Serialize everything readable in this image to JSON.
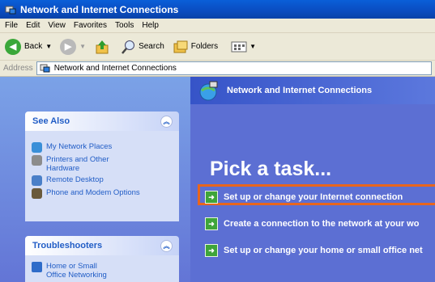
{
  "window": {
    "title": "Network and Internet Connections"
  },
  "menu": [
    "File",
    "Edit",
    "View",
    "Favorites",
    "Tools",
    "Help"
  ],
  "toolbar": {
    "back": "Back",
    "search": "Search",
    "folders": "Folders"
  },
  "address": {
    "label": "Address",
    "value": "Network and Internet Connections"
  },
  "left": {
    "see_also": {
      "title": "See Also",
      "items": [
        "My Network Places",
        "Printers and Other Hardware",
        "Remote Desktop",
        "Phone and Modem Options"
      ]
    },
    "troubleshooters": {
      "title": "Troubleshooters",
      "items": [
        "Home or Small Office Networking"
      ]
    }
  },
  "right": {
    "header": "Network and Internet Connections",
    "pick_task": "Pick a task...",
    "tasks": [
      "Set up or change your Internet connection",
      "Create a connection to the network at your wo",
      "Set up or change your home or small office net"
    ]
  },
  "colors": {
    "highlight": "#e8651d",
    "title_blue": "#0a4cc0",
    "pane_blue": "#5c6fd3"
  }
}
